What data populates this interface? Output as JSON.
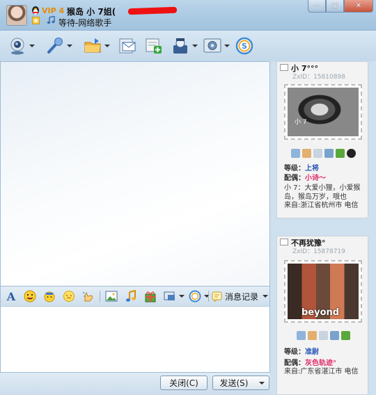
{
  "header": {
    "vip_label": "VIP 4",
    "contact_name": "猴岛  小 7姐(",
    "status_text": "等待-网络歌手"
  },
  "window_controls": {
    "minimize": "—",
    "maximize": "□",
    "close": "✕"
  },
  "toolbar": {
    "items": [
      "webcam-icon",
      "microphone-icon",
      "send-file-icon",
      "email-icon",
      "add-group-icon",
      "group-chat-icon",
      "settings-icon",
      "soso-icon"
    ]
  },
  "format_bar": {
    "message_log_label": "消息记录"
  },
  "buttons": {
    "close_label": "关闭(C)",
    "send_label": "发送(S)"
  },
  "cards": [
    {
      "name": "小 7°°°",
      "id_label": "ZxID：15810898",
      "photo_caption": "小 7",
      "rank_label": "等级：",
      "rank_value": "上将",
      "partner_label": "配偶：",
      "partner_value": "小诗～",
      "bio": "小 7：大爱小狸，小爱猴岛，猴岛万岁，哦也",
      "location": "来自:浙江省杭州市 电信"
    },
    {
      "name": "不再犹豫°",
      "id_label": "ZxID：15878719",
      "photo_caption": "beyond",
      "rank_label": "等级：",
      "rank_value": "准尉",
      "partner_label": "配偶：",
      "partner_value": "灰色轨迹°",
      "location": "来自:广东省湛江市 电信"
    }
  ],
  "colors": {
    "accent": "#2857b8",
    "partner": "#e0306a",
    "vip": "#e58a00",
    "redaction": "#ee1111"
  }
}
